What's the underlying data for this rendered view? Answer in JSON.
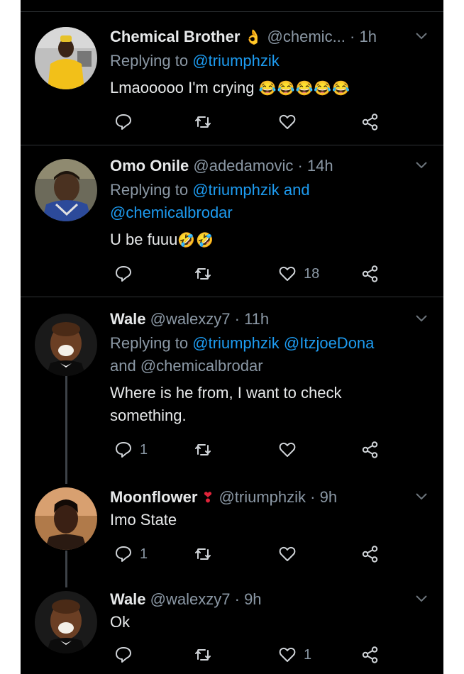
{
  "tweets": [
    {
      "name": "Chemical Brother",
      "name_emoji": "👌",
      "handle": "@chemic...",
      "time": "1h",
      "reply_prefix": "Replying to",
      "reply_line1": "@triumphzik",
      "reply_line1_rest": "",
      "reply_line2": "",
      "body_line1": "Lmaooooo I'm crying",
      "body_emoji": "😂😂😂😂😂",
      "body_line2": "",
      "reply_count": "",
      "retweet_count": "",
      "like_count": ""
    },
    {
      "name": "Omo Onile",
      "name_emoji": "",
      "handle": "@adedamovic",
      "time": "14h",
      "reply_prefix": "Replying to",
      "reply_line1": "@triumphzik and",
      "reply_line1_rest": "",
      "reply_line2": "@chemicalbrodar",
      "body_line1": "U be fuuu",
      "body_emoji": "🤣🤣",
      "body_line2": "",
      "reply_count": "",
      "retweet_count": "",
      "like_count": "18"
    },
    {
      "name": "Wale",
      "name_emoji": "",
      "handle": "@walexzy7",
      "time": "11h",
      "reply_prefix": "Replying to",
      "reply_line1": "@triumphzik @ItzjoeDona",
      "reply_line1_rest": "",
      "reply_line2": "and @chemicalbrodar",
      "body_line1": "Where is he from, I want to check",
      "body_emoji": "",
      "body_line2": "something.",
      "reply_count": "1",
      "retweet_count": "",
      "like_count": ""
    },
    {
      "name": "Moonflower",
      "name_emoji": "❣",
      "handle": "@triumphzik",
      "time": "9h",
      "reply_prefix": "",
      "reply_line1": "",
      "reply_line1_rest": "",
      "reply_line2": "",
      "body_line1": "Imo State",
      "body_emoji": "",
      "body_line2": "",
      "reply_count": "1",
      "retweet_count": "",
      "like_count": ""
    },
    {
      "name": "Wale",
      "name_emoji": "",
      "handle": "@walexzy7",
      "time": "9h",
      "reply_prefix": "",
      "reply_line1": "",
      "reply_line1_rest": "",
      "reply_line2": "",
      "body_line1": "Ok",
      "body_emoji": "",
      "body_line2": "",
      "reply_count": "",
      "retweet_count": "",
      "like_count": "1"
    }
  ],
  "separator": "·",
  "icons": {
    "reply": "reply-icon",
    "retweet": "retweet-icon",
    "like": "like-icon",
    "share": "share-icon",
    "more": "chevron-down-icon"
  },
  "colors": {
    "background": "#000000",
    "text": "#e7e9ea",
    "muted": "#8b98a5",
    "mention": "#1d9bf0",
    "divider": "#2f3336"
  }
}
